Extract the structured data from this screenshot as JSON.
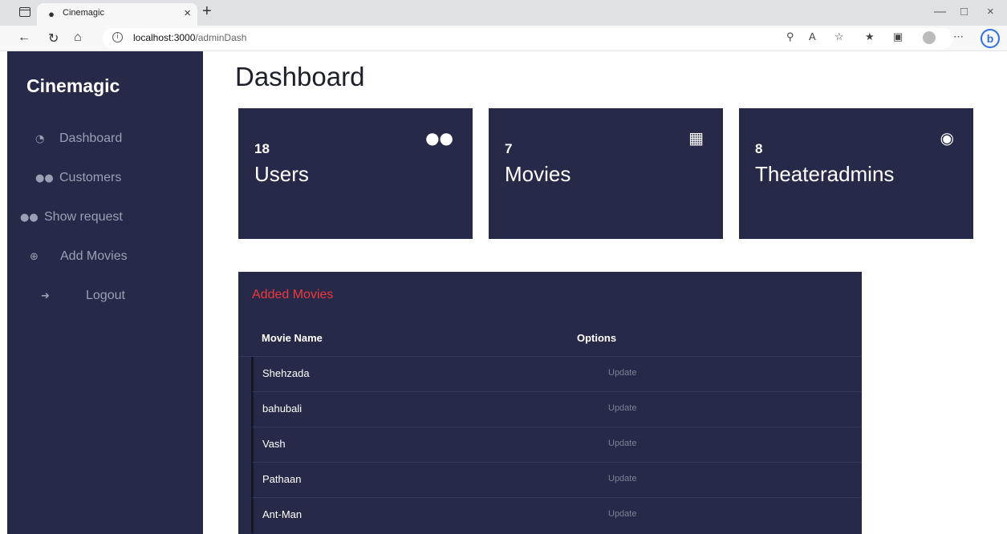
{
  "browser": {
    "tab_title": "Cinemagic",
    "url_host": "localhost:3000",
    "url_path": "/adminDash"
  },
  "sidebar": {
    "brand": "Cinemagic",
    "items": [
      {
        "label": "Dashboard",
        "icon": "dashboard-icon"
      },
      {
        "label": "Customers",
        "icon": "users-icon"
      },
      {
        "label": "Show request",
        "icon": "users-icon"
      },
      {
        "label": "Add Movies",
        "icon": "plus-circle-icon"
      },
      {
        "label": "Logout",
        "icon": "sign-out-icon"
      }
    ]
  },
  "main": {
    "title": "Dashboard",
    "cards": [
      {
        "count": "18",
        "label": "Users",
        "icon": "users-icon"
      },
      {
        "count": "7",
        "label": "Movies",
        "icon": "film-icon"
      },
      {
        "count": "8",
        "label": "Theateradmins",
        "icon": "user-circle-icon"
      }
    ],
    "movies_panel": {
      "title": "Added Movies",
      "columns": [
        "Movie Name",
        "Options"
      ],
      "rows": [
        {
          "name": "Shehzada",
          "option": "Update"
        },
        {
          "name": "bahubali",
          "option": "Update"
        },
        {
          "name": "Vash",
          "option": "Update"
        },
        {
          "name": "Pathaan",
          "option": "Update"
        },
        {
          "name": "Ant-Man",
          "option": "Update"
        }
      ]
    }
  },
  "colors": {
    "sidebar_bg": "#262a48",
    "accent_red": "#f0373f",
    "muted_text": "#9aa0b4"
  }
}
